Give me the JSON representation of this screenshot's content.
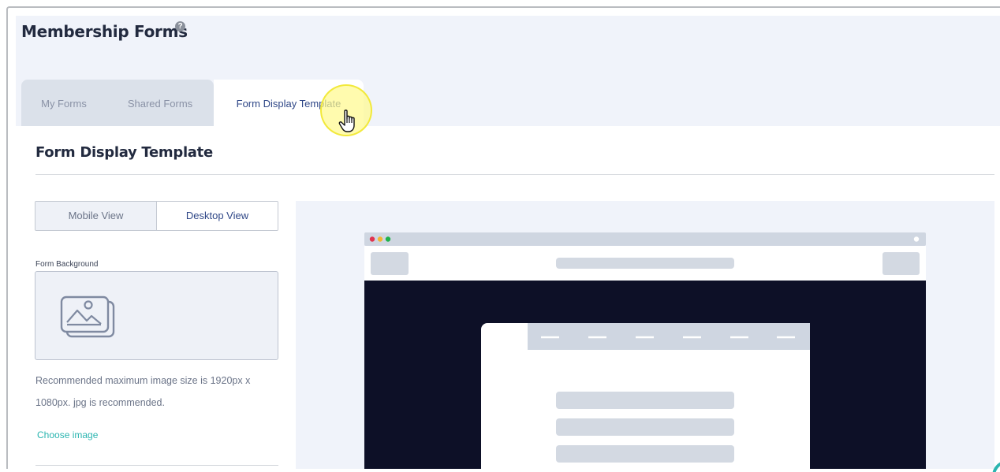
{
  "page": {
    "title": "Membership Forms",
    "help_icon": "question-circle-icon"
  },
  "tabs": [
    {
      "label": "My Forms",
      "active": false
    },
    {
      "label": "Shared Forms",
      "active": false
    },
    {
      "label": "Form Display Template",
      "active": true
    }
  ],
  "section": {
    "title": "Form Display Template"
  },
  "view_toggle": {
    "mobile_label": "Mobile View",
    "desktop_label": "Desktop View",
    "selected": "Desktop View"
  },
  "form_background": {
    "label": "Form Background",
    "placeholder_icon": "image-placeholder-icon",
    "hint": "Recommended maximum image size is 1920px x 1080px. jpg is recommended.",
    "choose_label": "Choose image"
  },
  "colors": {
    "accent_teal": "#2bb5b0",
    "active_tab_text": "#2f4787",
    "preview_dark": "#0d1027",
    "dot_red": "#e0344f",
    "dot_yellow": "#f2b632",
    "dot_green": "#1fb24c"
  }
}
